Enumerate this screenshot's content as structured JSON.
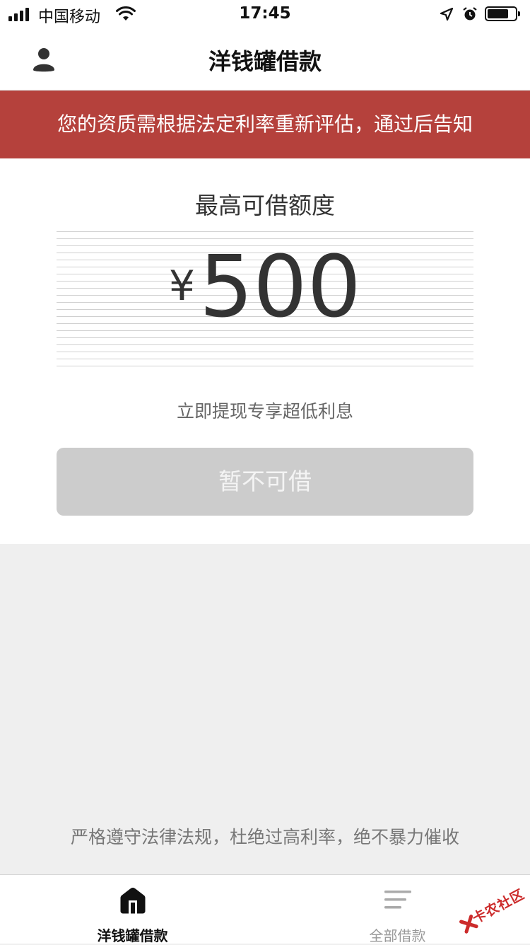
{
  "status_bar": {
    "carrier": "中国移动",
    "time": "17:45",
    "battery_level": 0.75
  },
  "nav": {
    "title": "洋钱罐借款",
    "user_icon": "user-icon"
  },
  "notice": {
    "text": "您的资质需根据法定利率重新评估，通过后告知",
    "background": "#b5413c"
  },
  "limit": {
    "label": "最高可借额度",
    "currency": "¥",
    "amount": "500",
    "promo": "立即提现专享超低利息"
  },
  "borrow_button": {
    "label": "暂不可借",
    "disabled": true
  },
  "compliance": {
    "text": "严格遵守法律法规，杜绝过高利率，绝不暴力催收"
  },
  "tab_bar": {
    "tabs": [
      {
        "label": "洋钱罐借款",
        "icon": "home-icon",
        "active": true
      },
      {
        "label": "全部借款",
        "icon": "list-icon",
        "active": false
      }
    ]
  },
  "watermark": {
    "text": "卡农社区"
  }
}
